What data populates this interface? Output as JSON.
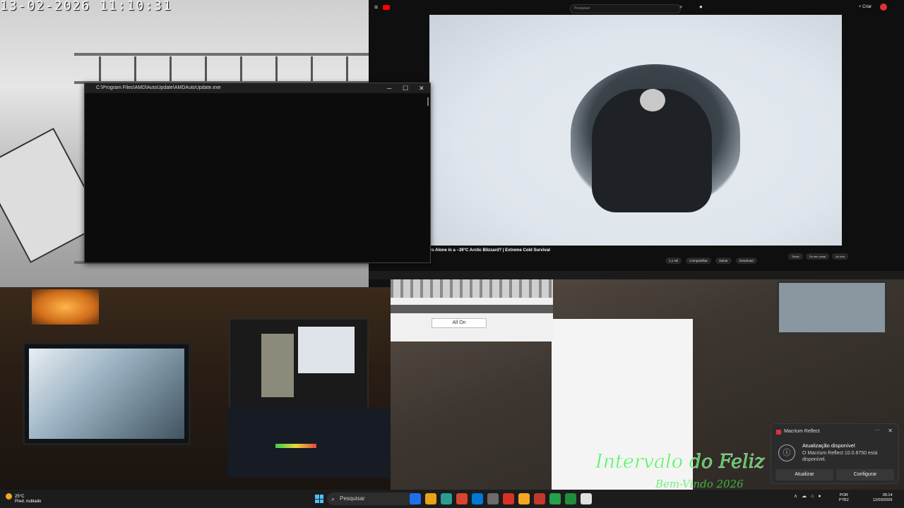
{
  "camera_top": {
    "timestamp": "13-02-2026 11:10:31"
  },
  "terminal": {
    "title": "C:\\Program Files\\AMD\\AutoUpdate\\AMDAutoUpdate.exe",
    "minimize": "─",
    "maximize": "☐",
    "close": "✕"
  },
  "youtube": {
    "search_placeholder": "Pesquisar",
    "video_title": "ys Alone in a −39°C Arctic Blizzard? | Extreme Cold Survival",
    "actions": [
      "1,1 mil",
      "Compartilhar",
      "Salvar",
      "Download"
    ],
    "chips": [
      "Todos",
      "Do seu canal",
      "Ao vivo"
    ],
    "create_label": "+ Criar"
  },
  "popup": {
    "button_label": "All On"
  },
  "overlay_text": {
    "line1": "Intervalo do Feliz",
    "line2": "Bem-Vindo 2026"
  },
  "toast": {
    "app_name": "Macrium Reflect",
    "more": "···",
    "close": "✕",
    "info_icon": "ⓘ",
    "heading": "Atualização disponível",
    "body": "O Macrium Reflect 10.0.8750 está disponível.",
    "button_update": "Atualizar",
    "button_configure": "Configurar"
  },
  "taskbar": {
    "weather_temp": "25°C",
    "weather_desc": "Pred. nublado",
    "search_label": "Pesquisar",
    "lang_line1": "POR",
    "lang_line2": "PTB2",
    "time": "05:14",
    "date": "12/03/2026",
    "app_colors": [
      "#1f6feb",
      "#e8a317",
      "#2a9d8f",
      "#d6452f",
      "#0078d4",
      "#6b6b6b",
      "#d93025",
      "#f5a623",
      "#c0392b",
      "#24a148",
      "#1e8e3e",
      "#e0e0e0"
    ]
  }
}
